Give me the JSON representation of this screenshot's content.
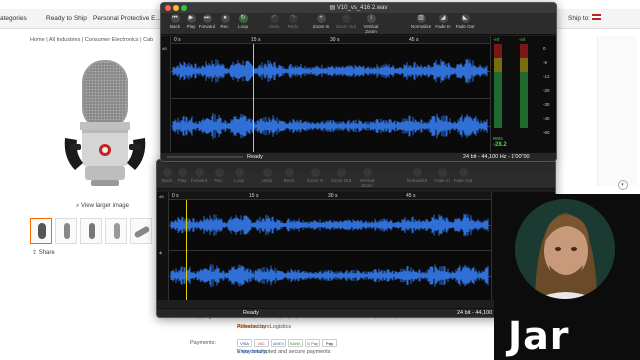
{
  "web": {
    "nav": [
      "ategories",
      "Ready to Ship",
      "Personal Protective E...",
      "Ship to:"
    ],
    "breadcrumb": "Home  |  All Industries  |  Consumer Electronics  |  Cab",
    "view_larger": "View larger image",
    "share": "Share",
    "shipping_label": "Shipping:",
    "shipping_text": "Lower-priced shipping by A.I. Frame via Ocean + Delivery Lower-priced",
    "powered_prefix": "Powered by",
    "powered_brand": "Alibaba.com",
    "powered_suffix": "Logistics",
    "payments_label": "Payments:",
    "payment_methods": [
      "VISA",
      "MC",
      "AMEX",
      "BANK",
      "G Pay",
      "Pay"
    ],
    "secure_prefix": "Enjoy encrypted and secure payments",
    "secure_link": "View details"
  },
  "window1": {
    "title": "V10_vs_416 2.wav",
    "toolbar": [
      {
        "icon": "back-icon",
        "glyph": "⏮",
        "label": "Back"
      },
      {
        "icon": "play-icon",
        "glyph": "▶",
        "label": "Play"
      },
      {
        "icon": "forward-icon",
        "glyph": "⏭",
        "label": "Forward"
      },
      {
        "icon": "record-icon",
        "glyph": "●",
        "label": "Rec."
      },
      {
        "icon": "loop-icon",
        "glyph": "↻",
        "label": "Loop"
      },
      {
        "icon": "undo-icon",
        "glyph": "↶",
        "label": "Undo"
      },
      {
        "icon": "redo-icon",
        "glyph": "↷",
        "label": "Redo"
      },
      {
        "icon": "zoom-in-icon",
        "glyph": "+",
        "label": "Zoom In"
      },
      {
        "icon": "zoom-out-icon",
        "glyph": "−",
        "label": "Zoom Out"
      },
      {
        "icon": "vertical-zoom-icon",
        "glyph": "↕",
        "label": "Vertical Zoom"
      },
      {
        "icon": "normalize-icon",
        "glyph": "▥",
        "label": "Normalize"
      },
      {
        "icon": "fade-in-icon",
        "glyph": "◢",
        "label": "Fade In"
      },
      {
        "icon": "fade-out-icon",
        "glyph": "◣",
        "label": "Fade Out"
      }
    ],
    "ruler": [
      "0 s",
      "15 s",
      "30 s",
      "45 s"
    ],
    "db_label": "dB",
    "status_left": "Ready",
    "status_right": "24 bit - 44,100 Hz - 1'00\"00",
    "meter_top": [
      "-inf",
      "-inf"
    ],
    "meter_ticks": [
      "0",
      "-6",
      "-12",
      "-20",
      "-30",
      "-40",
      "-60"
    ],
    "rms_label": "RMS",
    "rms_value": "-28.2"
  },
  "window2": {
    "toolbar": [
      "Back",
      "Play",
      "Forward",
      "Rec.",
      "Loop",
      "Undo",
      "Redo",
      "Zoom In",
      "Zoom Out",
      "Vertical Zoom",
      "Normalize",
      "Fade In",
      "Fade Out"
    ],
    "ruler": [
      "0 s",
      "15 s",
      "30 s",
      "45 s"
    ],
    "db_label": "dB",
    "status_left": "Ready",
    "status_right": "24 bit - 44,100"
  },
  "webcam": {
    "name": "Jar"
  },
  "colors": {
    "waveform": "#2f6fd6",
    "cursor": "#e6d200",
    "meter_green": "#2fa84a",
    "meter_yellow": "#c9b000",
    "meter_red": "#c02020"
  }
}
